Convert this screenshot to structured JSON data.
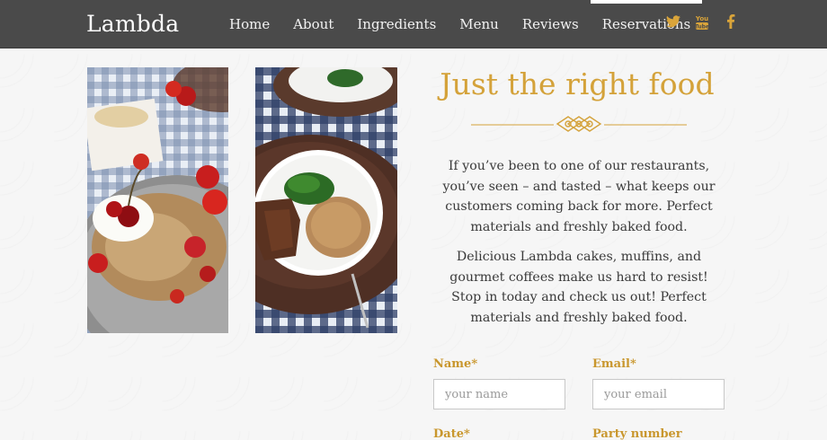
{
  "brand": "Lambda",
  "nav": {
    "items": [
      "Home",
      "About",
      "Ingredients",
      "Menu",
      "Reviews",
      "Reservations"
    ],
    "active": "Reservations"
  },
  "social": [
    {
      "icon": "twitter-icon",
      "glyph": "🐦"
    },
    {
      "icon": "youtube-icon",
      "glyph": "You Tube"
    },
    {
      "icon": "facebook-icon",
      "glyph": "f"
    }
  ],
  "colors": {
    "accent": "#d4a23a",
    "nav_bg": "#4a4a4a"
  },
  "main": {
    "title": "Just the right food",
    "paragraph_1": "If you’ve been to one of our restaurants, you’ve seen – and tasted – what keeps our customers coming back for more. Perfect materials and freshly baked food.",
    "paragraph_2": "Delicious Lambda cakes, muffins, and gourmet coffees make us hard to resist! Stop in today and check us out! Perfect materials and freshly baked food."
  },
  "form": {
    "name_label": "Name*",
    "name_placeholder": "your name",
    "email_label": "Email*",
    "email_placeholder": "your email",
    "date_label": "Date*",
    "party_label": "Party number"
  }
}
